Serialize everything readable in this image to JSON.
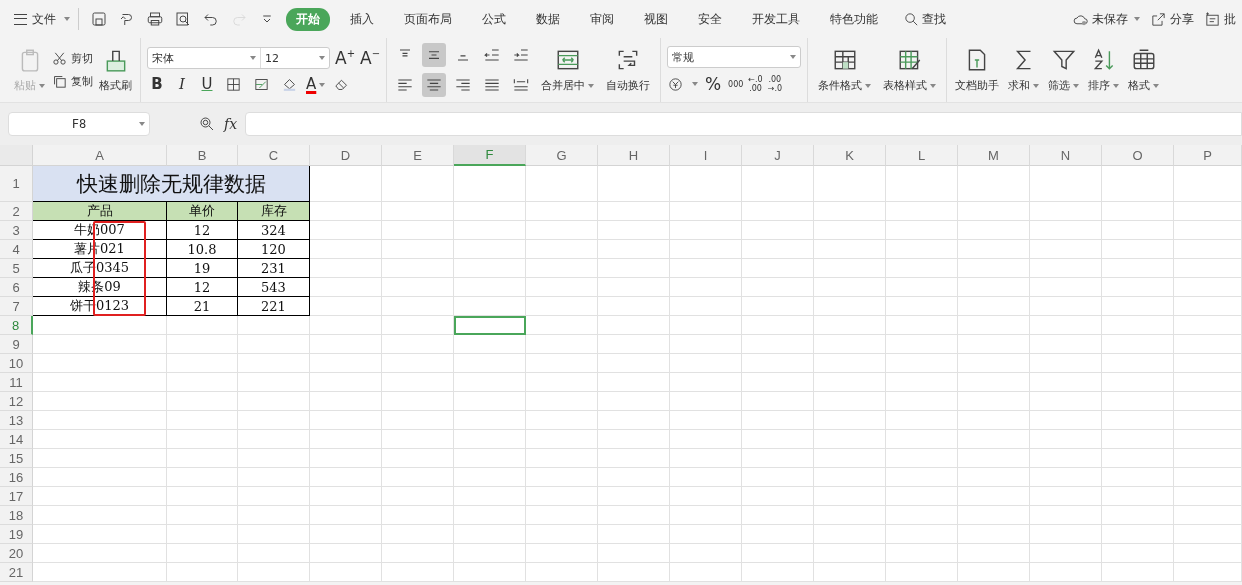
{
  "menu": {
    "label": "文件"
  },
  "quick_access": [
    {
      "kind": "save"
    },
    {
      "kind": "export"
    },
    {
      "kind": "print"
    },
    {
      "kind": "preview"
    },
    {
      "kind": "undo",
      "disabled": false
    },
    {
      "kind": "redo",
      "disabled": true
    },
    {
      "kind": "more"
    }
  ],
  "tabs": [
    {
      "label": "开始",
      "selected": true
    },
    {
      "label": "插入",
      "selected": false
    },
    {
      "label": "页面布局",
      "selected": false
    },
    {
      "label": "公式",
      "selected": false
    },
    {
      "label": "数据",
      "selected": false
    },
    {
      "label": "审阅",
      "selected": false
    },
    {
      "label": "视图",
      "selected": false
    },
    {
      "label": "安全",
      "selected": false
    },
    {
      "label": "开发工具",
      "selected": false
    },
    {
      "label": "特色功能",
      "selected": false
    }
  ],
  "search": {
    "label": "查找"
  },
  "account": [
    {
      "kind": "cloud",
      "label": "未保存",
      "dropdown": true
    },
    {
      "kind": "share",
      "label": "分享",
      "dropdown": false
    },
    {
      "kind": "note",
      "label": "批",
      "dropdown": false
    }
  ],
  "ribbon": {
    "clipboard": {
      "paste": {
        "label": "粘贴",
        "disabled": true
      },
      "cut": "剪切",
      "copy": "复制",
      "painter": "格式刷"
    },
    "font": {
      "name": "宋体",
      "size": "12",
      "grow": {
        "label": "A",
        "mark": "+"
      },
      "shrink": {
        "label": "A",
        "mark": "−"
      },
      "format": [
        {
          "kind": "bold",
          "label": "B"
        },
        {
          "kind": "italic",
          "label": "I"
        },
        {
          "kind": "underline",
          "label": "U"
        },
        {
          "kind": "borders"
        },
        {
          "kind": "pattern"
        },
        {
          "kind": "fill"
        },
        {
          "kind": "font-color",
          "label": "A"
        },
        {
          "kind": "clear"
        }
      ]
    },
    "alignment": {
      "top": [
        {
          "kind": "align-top",
          "selected": false
        },
        {
          "kind": "align-middle",
          "selected": true
        },
        {
          "kind": "align-bottom",
          "selected": false
        },
        {
          "kind": "indent-less",
          "selected": false
        },
        {
          "kind": "indent-more",
          "selected": false
        }
      ],
      "bottom": [
        {
          "kind": "align-left",
          "selected": false
        },
        {
          "kind": "align-center",
          "selected": true
        },
        {
          "kind": "align-right",
          "selected": false
        },
        {
          "kind": "justify",
          "selected": false
        },
        {
          "kind": "distribute",
          "selected": false
        }
      ],
      "merge": "合并居中",
      "wrap": "自动换行"
    },
    "number": {
      "format": "常规",
      "percent": "%",
      "thousands": "000",
      "increase": {
        "top": "←.0",
        "bottom": ".00"
      },
      "decrease": {
        "top": ".00",
        "bottom": "→.0"
      }
    },
    "styles": [
      {
        "label": "条件格式",
        "kind": "conditional"
      },
      {
        "label": "表格样式",
        "kind": "table-style"
      }
    ],
    "tools": [
      {
        "label": "文档助手",
        "kind": "doc",
        "dropdown": false
      },
      {
        "label": "求和",
        "kind": "sum",
        "dropdown": true
      },
      {
        "label": "筛选",
        "kind": "filter",
        "dropdown": true
      },
      {
        "label": "排序",
        "kind": "sort",
        "dropdown": true
      },
      {
        "label": "格式",
        "kind": "format",
        "dropdown": true
      }
    ]
  },
  "formula_bar": {
    "name_box": "F8",
    "fx": "fx"
  },
  "sheet": {
    "highlight": true,
    "columns": [
      {
        "label": "A",
        "selected": false
      },
      {
        "label": "B",
        "selected": false
      },
      {
        "label": "C",
        "selected": false
      },
      {
        "label": "D",
        "selected": false
      },
      {
        "label": "E",
        "selected": false
      },
      {
        "label": "F",
        "selected": true
      },
      {
        "label": "G",
        "selected": false
      },
      {
        "label": "H",
        "selected": false
      },
      {
        "label": "I",
        "selected": false
      },
      {
        "label": "J",
        "selected": false
      },
      {
        "label": "K",
        "selected": false
      },
      {
        "label": "L",
        "selected": false
      },
      {
        "label": "M",
        "selected": false
      },
      {
        "label": "N",
        "selected": false
      },
      {
        "label": "O",
        "selected": false
      },
      {
        "label": "P",
        "selected": false
      }
    ],
    "rows": [
      {
        "label": "1",
        "selected": false,
        "kind": "title",
        "cells": [
          "快速删除无规律数据"
        ]
      },
      {
        "label": "2",
        "selected": false,
        "kind": "header",
        "cells": [
          "产品",
          "单价",
          "库存"
        ]
      },
      {
        "label": "3",
        "selected": false,
        "kind": "data",
        "cells": [
          "牛奶007",
          "12",
          "324"
        ]
      },
      {
        "label": "4",
        "selected": false,
        "kind": "data",
        "cells": [
          "薯片021",
          "10.8",
          "120"
        ]
      },
      {
        "label": "5",
        "selected": false,
        "kind": "data",
        "cells": [
          "瓜子0345",
          "19",
          "231"
        ]
      },
      {
        "label": "6",
        "selected": false,
        "kind": "data",
        "cells": [
          "辣条09",
          "12",
          "543"
        ]
      },
      {
        "label": "7",
        "selected": false,
        "kind": "data",
        "cells": [
          "饼干0123",
          "21",
          "221"
        ]
      },
      {
        "label": "8",
        "selected": true,
        "kind": "empty"
      },
      {
        "label": "9",
        "selected": false,
        "kind": "empty"
      },
      {
        "label": "10",
        "selected": false,
        "kind": "empty"
      },
      {
        "label": "11",
        "selected": false,
        "kind": "empty"
      },
      {
        "label": "12",
        "selected": false,
        "kind": "empty"
      },
      {
        "label": "13",
        "selected": false,
        "kind": "empty"
      },
      {
        "label": "14",
        "selected": false,
        "kind": "empty"
      },
      {
        "label": "15",
        "selected": false,
        "kind": "empty"
      },
      {
        "label": "16",
        "selected": false,
        "kind": "empty"
      },
      {
        "label": "17",
        "selected": false,
        "kind": "empty"
      },
      {
        "label": "18",
        "selected": false,
        "kind": "empty"
      },
      {
        "label": "19",
        "selected": false,
        "kind": "empty"
      },
      {
        "label": "20",
        "selected": false,
        "kind": "empty"
      },
      {
        "label": "21",
        "selected": false,
        "kind": "empty"
      }
    ]
  }
}
